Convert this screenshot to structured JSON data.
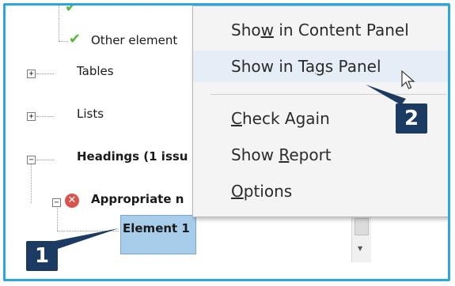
{
  "tree": {
    "items": [
      {
        "label": "Other element"
      },
      {
        "label": "Tables"
      },
      {
        "label": "Lists"
      },
      {
        "label": "Headings (1 issu"
      },
      {
        "label": "Appropriate n"
      },
      {
        "label": "Element 1"
      }
    ]
  },
  "menu": {
    "items": [
      {
        "pre": "Sho",
        "ul": "w",
        "post": " in Content Panel"
      },
      {
        "pre": "Show in Ta",
        "ul": "g",
        "post": "s Panel"
      },
      {
        "pre": "",
        "ul": "C",
        "post": "heck Again"
      },
      {
        "pre": "Show ",
        "ul": "R",
        "post": "eport"
      },
      {
        "pre": "",
        "ul": "O",
        "post": "ptions"
      }
    ]
  },
  "callouts": {
    "one": "1",
    "two": "2"
  },
  "colors": {
    "accent_border": "#2aa6e0",
    "callout_bg": "#1c3b62",
    "selection": "#a8cdea",
    "error": "#d9534f",
    "check": "#5bb53a"
  }
}
